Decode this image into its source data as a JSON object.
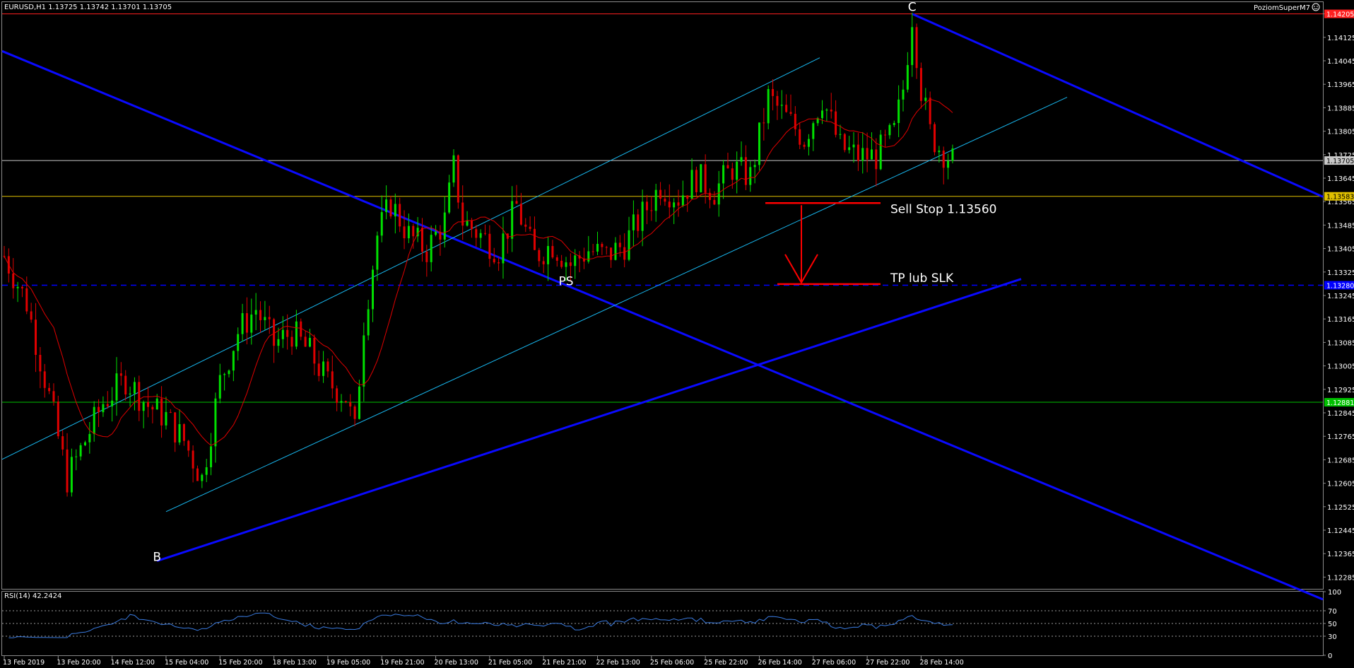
{
  "window": {
    "symbol_info": "EURUSD,H1  1.13725 1.13742 1.13701 1.13705",
    "indicator_name": "PoziomSuperM7",
    "indicator_icon": "smiley-icon"
  },
  "chart_data": {
    "type": "candlestick",
    "price_axis": {
      "ylim": [
        1.12245,
        1.14245
      ],
      "ticks": [
        "1.14205",
        "1.14125",
        "1.14045",
        "1.13965",
        "1.13885",
        "1.13805",
        "1.13725",
        "1.13645",
        "1.13565",
        "1.13485",
        "1.13405",
        "1.13325",
        "1.13245",
        "1.13165",
        "1.13085",
        "1.13005",
        "1.12925",
        "1.12845",
        "1.12765",
        "1.12685",
        "1.12605",
        "1.12525",
        "1.12445",
        "1.12365",
        "1.12285"
      ]
    },
    "time_axis": {
      "bars_visible": 358,
      "labels": [
        {
          "bar": 0,
          "text": "13 Feb 2019"
        },
        {
          "bar": 12,
          "text": "13 Feb 20:00"
        },
        {
          "bar": 24,
          "text": "14 Feb 12:00"
        },
        {
          "bar": 36,
          "text": "15 Feb 04:00"
        },
        {
          "bar": 48,
          "text": "15 Feb 20:00"
        },
        {
          "bar": 60,
          "text": "18 Feb 13:00"
        },
        {
          "bar": 72,
          "text": "19 Feb 05:00"
        },
        {
          "bar": 84,
          "text": "19 Feb 21:00"
        },
        {
          "bar": 96,
          "text": "20 Feb 13:00"
        },
        {
          "bar": 108,
          "text": "21 Feb 05:00"
        },
        {
          "bar": 120,
          "text": "21 Feb 21:00"
        },
        {
          "bar": 132,
          "text": "22 Feb 13:00"
        },
        {
          "bar": 144,
          "text": "25 Feb 06:00"
        },
        {
          "bar": 156,
          "text": "25 Feb 22:00"
        },
        {
          "bar": 168,
          "text": "26 Feb 14:00"
        },
        {
          "bar": 180,
          "text": "27 Feb 06:00"
        },
        {
          "bar": 192,
          "text": "27 Feb 22:00"
        },
        {
          "bar": 204,
          "text": "28 Feb 14:00"
        }
      ]
    },
    "price_path": [
      [
        0,
        1.1338
      ],
      [
        5,
        1.1322
      ],
      [
        10,
        1.129
      ],
      [
        14,
        1.1262
      ],
      [
        18,
        1.1275
      ],
      [
        22,
        1.1288
      ],
      [
        27,
        1.1296
      ],
      [
        32,
        1.1287
      ],
      [
        36,
        1.1283
      ],
      [
        40,
        1.1275
      ],
      [
        44,
        1.1262
      ],
      [
        48,
        1.1295
      ],
      [
        52,
        1.1312
      ],
      [
        56,
        1.132
      ],
      [
        60,
        1.1308
      ],
      [
        64,
        1.1312
      ],
      [
        68,
        1.1305
      ],
      [
        72,
        1.1295
      ],
      [
        76,
        1.129
      ],
      [
        78,
        1.1278
      ],
      [
        80,
        1.1315
      ],
      [
        83,
        1.1345
      ],
      [
        86,
        1.1356
      ],
      [
        90,
        1.1345
      ],
      [
        94,
        1.134
      ],
      [
        98,
        1.135
      ],
      [
        100,
        1.1368
      ],
      [
        102,
        1.135
      ],
      [
        106,
        1.1345
      ],
      [
        110,
        1.134
      ],
      [
        114,
        1.1355
      ],
      [
        118,
        1.1338
      ],
      [
        122,
        1.1342
      ],
      [
        126,
        1.1335
      ],
      [
        130,
        1.134
      ],
      [
        134,
        1.1338
      ],
      [
        138,
        1.1342
      ],
      [
        142,
        1.1352
      ],
      [
        146,
        1.1362
      ],
      [
        150,
        1.1358
      ],
      [
        154,
        1.1365
      ],
      [
        158,
        1.136
      ],
      [
        162,
        1.1368
      ],
      [
        166,
        1.1365
      ],
      [
        170,
        1.1392
      ],
      [
        174,
        1.1385
      ],
      [
        178,
        1.1378
      ],
      [
        182,
        1.1392
      ],
      [
        186,
        1.1375
      ],
      [
        190,
        1.1372
      ],
      [
        194,
        1.1372
      ],
      [
        198,
        1.138
      ],
      [
        200,
        1.1395
      ],
      [
        202,
        1.142
      ],
      [
        204,
        1.1395
      ],
      [
        206,
        1.138
      ],
      [
        208,
        1.1375
      ],
      [
        210,
        1.1372
      ],
      [
        211,
        1.13705
      ]
    ],
    "annotations": {
      "labels": [
        {
          "text": "C",
          "bar": 202,
          "price": 1.14215
        },
        {
          "text": "B",
          "bar": 34,
          "price": 1.1234
        },
        {
          "text": "PS",
          "bar": 125,
          "price": 1.1328
        }
      ],
      "sell_stop": {
        "text": "Sell Stop 1.13560",
        "price": 1.1356
      },
      "take_profit": {
        "text": "TP lub SLK",
        "price": 1.13284
      }
    },
    "horizontal_levels": [
      {
        "price": 1.14205,
        "label": "1.14205",
        "color": "#ff2020",
        "style": "solid"
      },
      {
        "price": 1.13705,
        "label": "1.13705",
        "color": "#c8c8c8",
        "style": "solid"
      },
      {
        "price": 1.13583,
        "label": "1.13583",
        "color": "#e0c000",
        "style": "solid"
      },
      {
        "price": 1.1328,
        "label": "1.13280",
        "color": "#0000ff",
        "style": "dashed"
      },
      {
        "price": 1.12881,
        "label": "1.12881",
        "color": "#00c000",
        "style": "solid"
      }
    ],
    "trend_lines": {
      "down_channel_color": "#0a0aff",
      "up_channel_color": "#18b8f0"
    },
    "rsi": {
      "label": "RSI(14) 42.2424",
      "ylim": [
        0,
        100
      ],
      "ticks": [
        "100",
        "70",
        "50",
        "30",
        "0"
      ],
      "levels": [
        70,
        50,
        30
      ],
      "color": "#3a7be0"
    },
    "colors": {
      "bull_candle": "#00e000",
      "bear_candle": "#e00000",
      "moving_average": "#e00000",
      "grid_text": "#ffffff",
      "arrow": "#ff0000"
    }
  }
}
